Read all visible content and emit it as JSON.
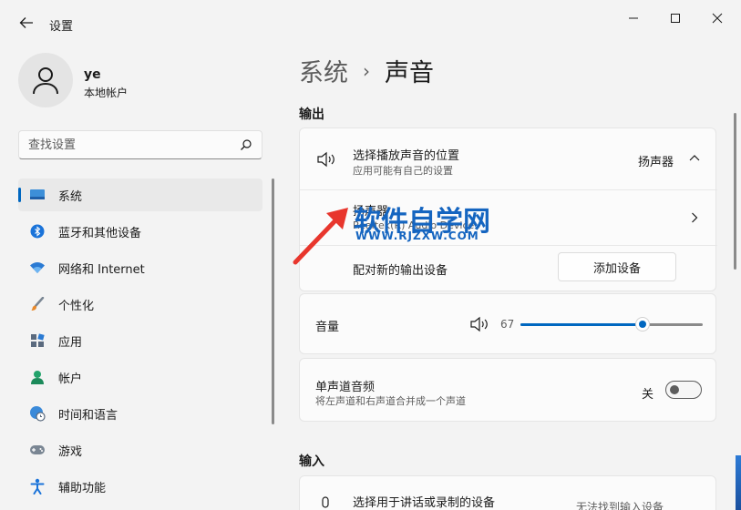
{
  "window": {
    "title": "设置"
  },
  "profile": {
    "name": "ye",
    "account_type": "本地帐户"
  },
  "search": {
    "placeholder": "查找设置"
  },
  "nav": {
    "items": [
      {
        "label": "系统",
        "icon": "monitor-icon",
        "active": true
      },
      {
        "label": "蓝牙和其他设备",
        "icon": "bluetooth-icon"
      },
      {
        "label": "网络和 Internet",
        "icon": "wifi-icon"
      },
      {
        "label": "个性化",
        "icon": "brush-icon"
      },
      {
        "label": "应用",
        "icon": "apps-icon"
      },
      {
        "label": "帐户",
        "icon": "person-icon"
      },
      {
        "label": "时间和语言",
        "icon": "globe-clock-icon"
      },
      {
        "label": "游戏",
        "icon": "gamepad-icon"
      },
      {
        "label": "辅助功能",
        "icon": "accessibility-icon"
      }
    ]
  },
  "breadcrumb": {
    "parent": "系统",
    "separator": "›",
    "current": "声音"
  },
  "output": {
    "section_label": "输出",
    "choose_title": "选择播放声音的位置",
    "choose_subtitle": "应用可能有自己的设置",
    "selected_device": "扬声器",
    "device_title": "扬声器",
    "device_subtitle": "Realtek(R) Audio Device",
    "pair_label": "配对新的输出设备",
    "add_device_button": "添加设备"
  },
  "volume": {
    "label": "音量",
    "value": 67
  },
  "mono": {
    "title": "单声道音频",
    "subtitle": "将左声道和右声道合并成一个声道",
    "state_label": "关",
    "on": false
  },
  "input": {
    "section_label": "输入",
    "choose_title": "选择用于讲话或录制的设备",
    "status_text": "无法找到输入设备"
  },
  "watermark": {
    "main": "软件自学网",
    "url": "WWW.RJZXW.COM"
  },
  "colors": {
    "accent": "#0067c0",
    "arrow": "#e8362d",
    "watermark": "#1565c0"
  }
}
